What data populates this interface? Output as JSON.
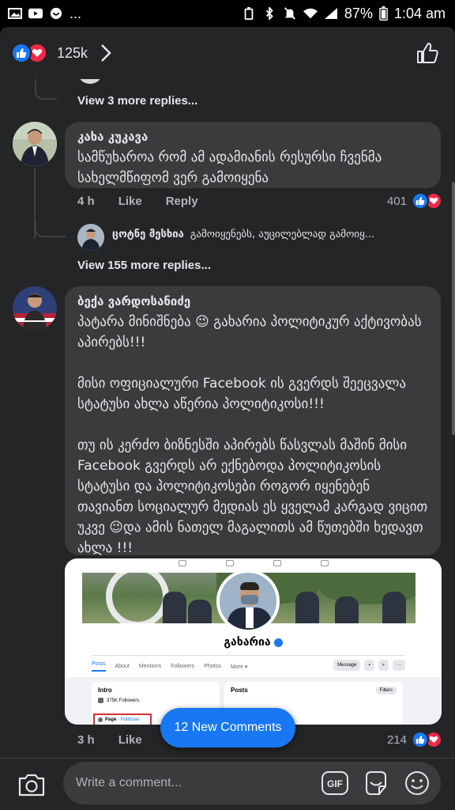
{
  "status_bar": {
    "more": "...",
    "battery": "87%",
    "time": "1:04 am"
  },
  "header": {
    "reaction_count": "125k",
    "reaction_icons": [
      "like-icon",
      "love-icon"
    ],
    "like_page_icon": "thumbs-up-outline-icon"
  },
  "thread": {
    "view_more_top": "View 3 more replies..."
  },
  "comments": [
    {
      "author": "კახა კუკავა",
      "text": "სამწუხაროა რომ ამ ადამიანის რესურსი ჩვენმა სახელმწიფომ ვერ გამოიყენა",
      "time": "4 h",
      "like_label": "Like",
      "reply_label": "Reply",
      "reaction_count": "401",
      "reply_preview": {
        "author": "ცოტნე მესხია",
        "text": "გამოიყენებს, აუცილებლად გამოიყ..."
      },
      "view_more": "View 155 more replies..."
    },
    {
      "author": "ბექა ვარდოსანიძე",
      "text": "პატარა მინიშნება 😉 გახარია პოლიტიკურ აქტივობას აპირებს!!!\n\nმისი ოფიციალური Facebook ის გვერდს შეეცვალა სტატუსი ახლა აწერია პოლიტიკოსი!!!\n\nთუ ის კერძო ბიზნესში აპირებს წასვლას მაშინ მისი Facebook გვერდს არ ექნებოდა პოლიტიკოსის სტატუსი და პოლიტიკოსები როგორ იყენებენ თავიანთ სოციალურ მედიას ეს ყველამ კარგად ვიცით უკვე 😉და ამის ნათელ მაგალითს ამ წუთებში ხედავთ ახლა !!!",
      "time": "3 h",
      "like_label": "Like",
      "reaction_count": "214",
      "attachment": {
        "page_name": "გახარია",
        "tabs": [
          "Posts",
          "About",
          "Mentions",
          "Followers",
          "Photos",
          "More ▾"
        ],
        "message_label": "Message",
        "intro_title": "Intro",
        "followers": "375K Followers",
        "page_type_prefix": "Page",
        "page_type": "Politician",
        "posts_title": "Posts",
        "filters_label": "Filters"
      }
    }
  ],
  "new_comments": "12 New Comments",
  "composer": {
    "placeholder": "Write a comment...",
    "gif_label": "GIF",
    "icons": [
      "camera-icon",
      "gif-icon",
      "sticker-icon",
      "emoji-icon"
    ]
  },
  "colors": {
    "background": "#242526",
    "bubble": "#3a3b3c",
    "accent": "#1877f2",
    "love": "#f02849"
  }
}
